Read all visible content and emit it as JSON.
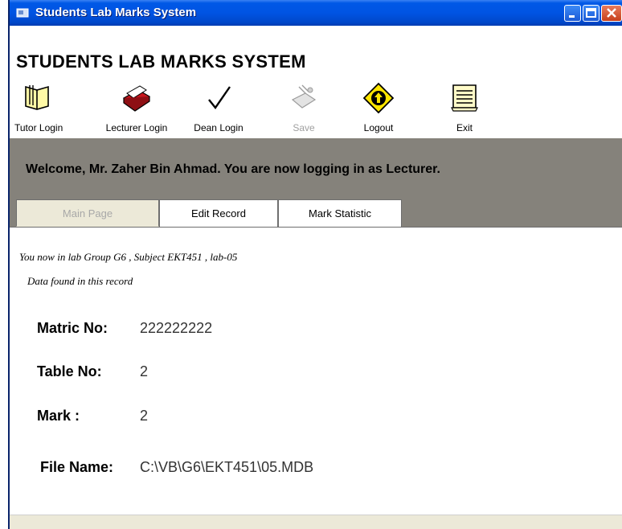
{
  "window": {
    "title": "Students Lab Marks System",
    "colors": {
      "titlebar": "#0054e3",
      "banner": "#85827b",
      "close": "#c7401c"
    }
  },
  "header": {
    "heading": "STUDENTS LAB MARKS SYSTEM"
  },
  "toolbar": {
    "tutor_login": "Tutor Login",
    "lecturer_login": "Lecturer Login",
    "dean_login": "Dean Login",
    "save": "Save",
    "logout": "Logout",
    "exit": "Exit"
  },
  "banner": {
    "welcome": "Welcome, Mr. Zaher Bin Ahmad. You are now logging in as Lecturer."
  },
  "tabs": {
    "main_page": "Main Page",
    "edit_record": "Edit Record",
    "mark_statistic": "Mark Statistic"
  },
  "content": {
    "lab_info": "You now in lab Group G6 , Subject EKT451 , lab-05",
    "data_status": "Data found in this record",
    "matric_label": "Matric No:",
    "matric_value": "222222222",
    "table_label": "Table No:",
    "table_value": "2",
    "mark_label": "Mark :",
    "mark_value": "2",
    "file_label": "File Name:",
    "file_value": "C:\\VB\\G6\\EKT451\\05.MDB"
  }
}
